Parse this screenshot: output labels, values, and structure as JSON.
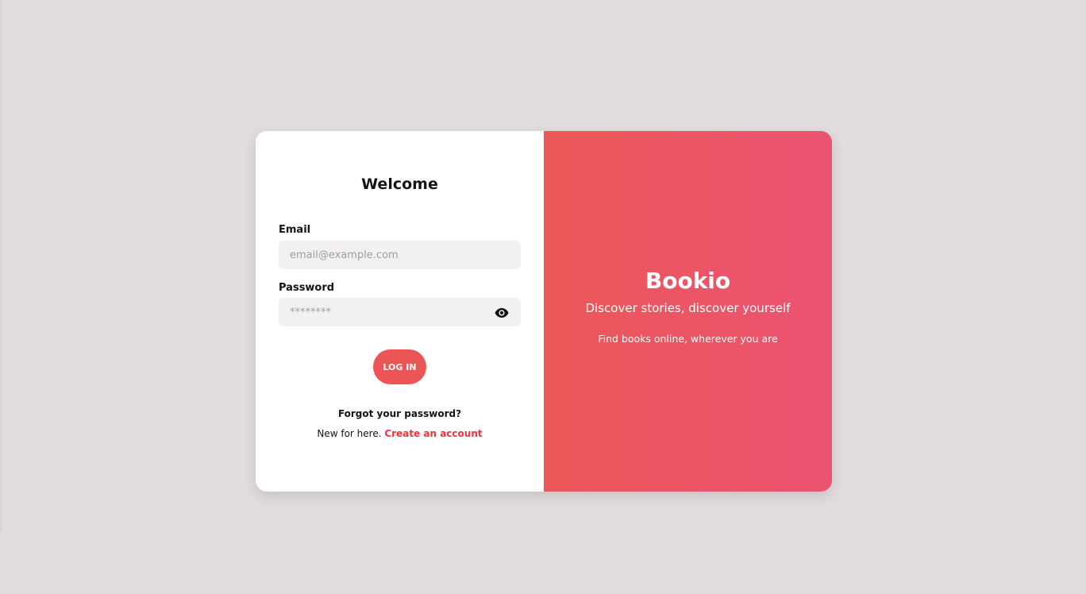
{
  "login": {
    "title": "Welcome",
    "email_label": "Email",
    "email_placeholder": "email@example.com",
    "password_label": "Password",
    "password_placeholder": "********",
    "login_button": "LOG IN",
    "forgot_password": "Forgot your password?",
    "signup_prefix": "New for here.",
    "signup_link": "Create an account"
  },
  "brand_panel": {
    "name": "Bookio",
    "tagline": "Discover stories, discover yourself",
    "subline": "Find books online, wherever you are"
  },
  "icons": {
    "password_toggle": "eye-icon"
  },
  "colors": {
    "background": "#e2dcdd",
    "accent": "#ec5555",
    "accent_gradient_end": "#ec5372",
    "link": "#e8363d",
    "input_background": "#f2f0f1"
  }
}
